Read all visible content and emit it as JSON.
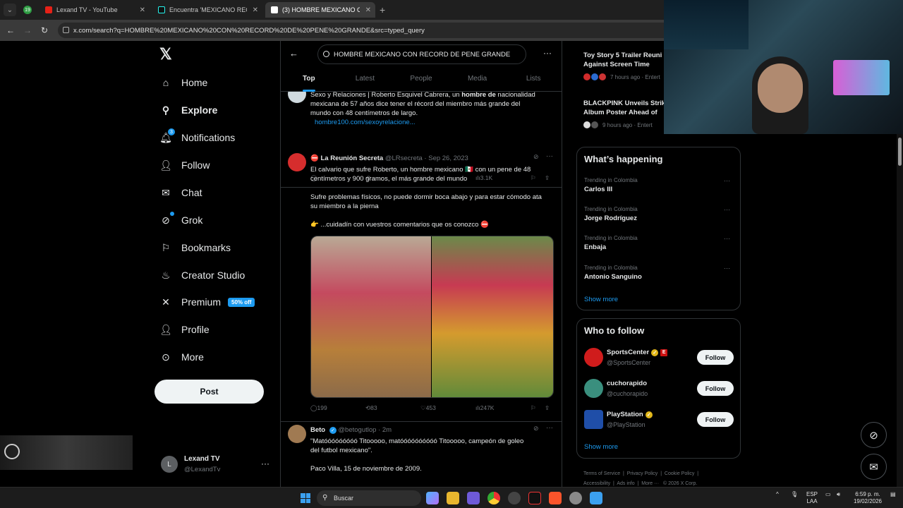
{
  "browser": {
    "tabs": [
      {
        "title": "Lexand TV - YouTube"
      },
      {
        "title": "Encuentra 'MEXICANO RECORD"
      },
      {
        "title": "(3) HOMBRE MEXICANO CON R"
      }
    ],
    "tab_count_badge": "19",
    "url": "x.com/search?q=HOMBRE%20MEXICANO%20CON%20RECORD%20DE%20PENE%20GRANDE&src=typed_query"
  },
  "sidebar": {
    "items": [
      {
        "label": "Home",
        "icon": "home-icon"
      },
      {
        "label": "Explore",
        "icon": "search-icon"
      },
      {
        "label": "Notifications",
        "icon": "bell-icon",
        "badge": "3"
      },
      {
        "label": "Follow",
        "icon": "person-add-icon"
      },
      {
        "label": "Chat",
        "icon": "mail-icon"
      },
      {
        "label": "Grok",
        "icon": "grok-icon"
      },
      {
        "label": "Bookmarks",
        "icon": "bookmark-icon"
      },
      {
        "label": "Creator Studio",
        "icon": "creator-icon"
      },
      {
        "label": "Premium",
        "icon": "x-icon",
        "pill": "50% off"
      },
      {
        "label": "Profile",
        "icon": "person-icon"
      },
      {
        "label": "More",
        "icon": "more-icon"
      }
    ],
    "post_button": "Post",
    "account": {
      "avatar_letter": "L",
      "name": "Lexand TV",
      "handle": "@LexandTv"
    }
  },
  "search": {
    "query": "HOMBRE MEXICANO CON RECORD DE PENE GRANDE",
    "tabs": [
      "Top",
      "Latest",
      "People",
      "Media",
      "Lists"
    ],
    "active_tab": "Top"
  },
  "posts": [
    {
      "text_line1_a": "Sexo y Relaciones | Roberto Esquivel Cabrera, un ",
      "text_line1_b": "hombre de",
      "text_line1_c": " nacionalidad",
      "text_line2": "mexicana de 57 años dice tener el récord del miembro más grande del",
      "text_line3": "mundo con 48 centímetros de largo.",
      "link": "hombre100.com/sexoyrelacione...",
      "views": "3.1K"
    },
    {
      "author": "La Reunión Secreta",
      "handle": "@LRsecreta",
      "date": "Sep 26, 2023",
      "line1": "El calvario que sufre Roberto, un hombre mexicano 🇲🇽 con un pene de 48",
      "line2": "centímetros y 900 gramos, el más grande del mundo",
      "line3": "Sufre problemas físicos, no puede dormir boca abajo y para estar cómodo ata",
      "line4": "su miembro a la pierna",
      "line5": "👉 ...cuidadín con vuestros comentarios que os conozco ⛔",
      "replies": "199",
      "reposts": "83",
      "likes": "453",
      "views": "247K"
    },
    {
      "author": "Beto",
      "handle": "@betogutlop",
      "date": "2m",
      "line1": "\"Matóóóóóóóóó Titooooo, matóóóóóóóóóó Titooooo, campeón de goleo",
      "line2": "del futbol mexicano\".",
      "line3": "Paco Villa, 15 de noviembre de 2009."
    }
  ],
  "news": [
    {
      "title_line1": "Toy Story 5 Trailer Reuni",
      "title_line2": "Against Screen Time",
      "meta": "7 hours ago · Entert"
    },
    {
      "title_line1": "BLACKPINK Unveils Strik",
      "title_line2": "Album Poster Ahead of",
      "meta": "9 hours ago · Entert"
    }
  ],
  "whats_happening": {
    "title": "What’s happening",
    "trends": [
      {
        "meta": "Trending in Colombia",
        "name": "Carlos III"
      },
      {
        "meta": "Trending in Colombia",
        "name": "Jorge Rodríguez"
      },
      {
        "meta": "Trending in Colombia",
        "name": "Enbaja"
      },
      {
        "meta": "Trending in Colombia",
        "name": "Antonio Sanguino"
      }
    ],
    "show_more": "Show more"
  },
  "who_to_follow": {
    "title": "Who to follow",
    "accounts": [
      {
        "name": "SportsCenter",
        "handle": "@SportsCenter",
        "button": "Follow",
        "avatar_color": "#d01c1c"
      },
      {
        "name": "cuchorapido",
        "handle": "@cuchorapido",
        "button": "Follow",
        "avatar_color": "#3a8f7e"
      },
      {
        "name": "PlayStation",
        "handle": "@PlayStation",
        "button": "Follow",
        "avatar_color": "#1f4ea8"
      }
    ],
    "show_more": "Show more"
  },
  "footer": {
    "line1": [
      "Terms of Service",
      "Privacy Policy",
      "Cookie Policy"
    ],
    "line2": [
      "Accessibility",
      "Ads info",
      "More ···",
      "© 2026 X Corp."
    ]
  },
  "taskbar": {
    "search_placeholder": "Buscar",
    "lang": "ESP",
    "lang2": "LAA",
    "time": "6:59 p. m.",
    "date": "19/02/2026"
  },
  "colors": {
    "accent": "#1d9bf0",
    "background": "#000000",
    "border": "#2f3336",
    "muted": "#71767b"
  }
}
